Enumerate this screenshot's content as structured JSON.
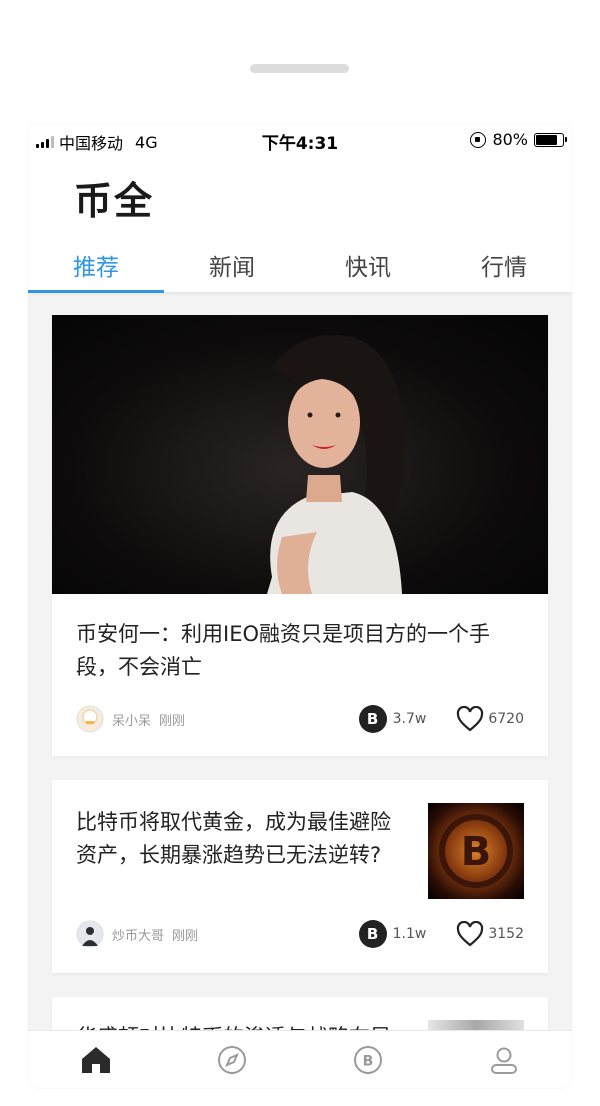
{
  "status_bar": {
    "carrier": "中国移动",
    "network": "4G",
    "time": "下午4:31",
    "battery": "80%",
    "battery_level": 0.8
  },
  "app": {
    "title": "币全",
    "accent_color": "#2d97e6"
  },
  "tabs": [
    {
      "label": "推荐",
      "active": true
    },
    {
      "label": "新闻",
      "active": false
    },
    {
      "label": "快讯",
      "active": false
    },
    {
      "label": "行情",
      "active": false
    }
  ],
  "articles": [
    {
      "title": "币安何一：利用IEO融资只是项目方的一个手段，不会消亡",
      "author": "呆小呆",
      "time": "刚刚",
      "coin_count": "3.7w",
      "likes": "6720",
      "coin_icon": "B"
    },
    {
      "title": "比特币将取代黄金，成为最佳避险资产，长期暴涨趋势已无法逆转?",
      "author": "炒币大哥",
      "time": "刚刚",
      "coin_count": "1.1w",
      "likes": "3152",
      "coin_icon": "B"
    },
    {
      "title": "华盛顿对比特币的渗透与战略布局"
    }
  ],
  "bottom_nav": [
    {
      "icon": "home-icon",
      "active": true
    },
    {
      "icon": "compass-icon",
      "active": false
    },
    {
      "icon": "bitcoin-icon",
      "active": false
    },
    {
      "icon": "user-icon",
      "active": false
    }
  ]
}
